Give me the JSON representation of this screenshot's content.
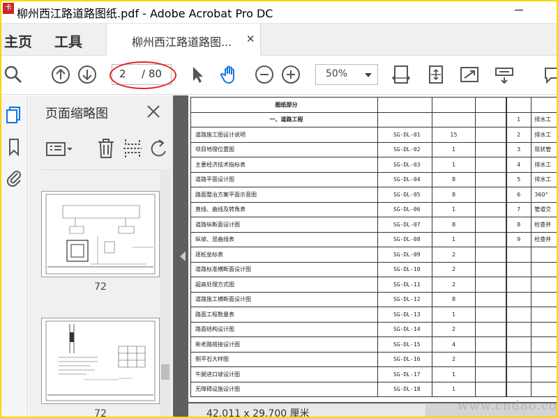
{
  "window": {
    "title": "柳州西江路道路图纸.pdf - Adobe Acrobat Pro DC",
    "badge": "卡"
  },
  "tabs": {
    "home": "主页",
    "tools": "工具",
    "document": "柳州西江路道路图...",
    "close_symbol": "✕"
  },
  "toolbar": {
    "page_current": "2",
    "page_total": "/ 80",
    "zoom": "50%",
    "icons": [
      "search-icon",
      "page-up-icon",
      "page-down-icon",
      "select-cursor-icon",
      "hand-icon",
      "zoom-out-icon",
      "zoom-in-icon",
      "fit-width-icon",
      "fit-page-icon",
      "full-screen-icon",
      "scroll-mode-icon",
      "comment-icon"
    ],
    "highlight_color": "#e02020"
  },
  "thumbnails": {
    "title": "页面缩略图",
    "pages": [
      {
        "label": "72"
      },
      {
        "label": "72"
      }
    ]
  },
  "document": {
    "page_size": "42.011 x 29.700 厘米",
    "table": {
      "header": "图纸部分",
      "section": "一、道路工程",
      "rows": [
        {
          "name": "道路施工图设计说明",
          "code": "SG-DL-01",
          "qty": "15"
        },
        {
          "name": "项目地理位置图",
          "code": "SG-DL-02",
          "qty": "1"
        },
        {
          "name": "主要经济技术指标表",
          "code": "SG-DL-03",
          "qty": "1"
        },
        {
          "name": "道路平面设计图",
          "code": "SG-DL-04",
          "qty": "8"
        },
        {
          "name": "路面整治方案平面示意图",
          "code": "SG-DL-05",
          "qty": "8"
        },
        {
          "name": "直线、曲线及转角表",
          "code": "SG-DL-06",
          "qty": "1"
        },
        {
          "name": "道路纵断面设计图",
          "code": "SG-DL-07",
          "qty": "8"
        },
        {
          "name": "纵坡、竖曲线表",
          "code": "SG-DL-08",
          "qty": "1"
        },
        {
          "name": "逐桩坐标表",
          "code": "SG-DL-09",
          "qty": "2"
        },
        {
          "name": "道路标准横断面设计图",
          "code": "SG-DL-10",
          "qty": "2"
        },
        {
          "name": "超高处理方式图",
          "code": "SG-DL-11",
          "qty": "2"
        },
        {
          "name": "道路施工横断面设计图",
          "code": "SG-DL-12",
          "qty": "8"
        },
        {
          "name": "路面工程数量表",
          "code": "SG-DL-13",
          "qty": "1"
        },
        {
          "name": "路面结构设计图",
          "code": "SG-DL-14",
          "qty": "2"
        },
        {
          "name": "新老路搭接设计图",
          "code": "SG-DL-15",
          "qty": "4"
        },
        {
          "name": "侧平石大样图",
          "code": "SG-DL-16",
          "qty": "2"
        },
        {
          "name": "牛腿进口坡设计图",
          "code": "SG-DL-17",
          "qty": "1"
        },
        {
          "name": "无障碍设施设计图",
          "code": "SG-DL-18",
          "qty": "1"
        }
      ],
      "side_rows": [
        {
          "n": "1",
          "t": "排水工"
        },
        {
          "n": "2",
          "t": "排水工"
        },
        {
          "n": "3",
          "t": "现状管"
        },
        {
          "n": "4",
          "t": "排水工"
        },
        {
          "n": "5",
          "t": "排水工"
        },
        {
          "n": "6",
          "t": "360°"
        },
        {
          "n": "7",
          "t": "管道交"
        },
        {
          "n": "8",
          "t": "检查井"
        },
        {
          "n": "9",
          "t": "检查井"
        }
      ]
    }
  },
  "watermark": "www.cndao.com"
}
